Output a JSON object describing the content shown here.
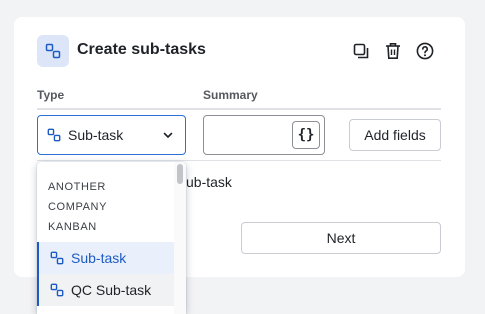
{
  "dialog": {
    "title": "Create sub-tasks",
    "icons": {
      "title": "subtask-icon",
      "copy": "copy-icon",
      "delete": "trash-icon",
      "help": "help-icon"
    }
  },
  "table": {
    "columns": {
      "type": "Type",
      "summary": "Summary"
    },
    "row": {
      "type_value": "Sub-task",
      "summary_value": "",
      "summary_button_text": "{}",
      "add_fields_label": "Add fields",
      "partial_text": "ub-task"
    }
  },
  "dropdown": {
    "group_label": "ANOTHER COMPANY KANBAN",
    "options": [
      {
        "label": "Sub-task",
        "state": "selected"
      },
      {
        "label": "QC Sub-task",
        "state": "hovered"
      }
    ]
  },
  "footer": {
    "next_label": "Next"
  },
  "colors": {
    "accent": "#1d5bc3",
    "focus_border": "#2d6fd6",
    "icon_bg": "#dde6f8"
  }
}
